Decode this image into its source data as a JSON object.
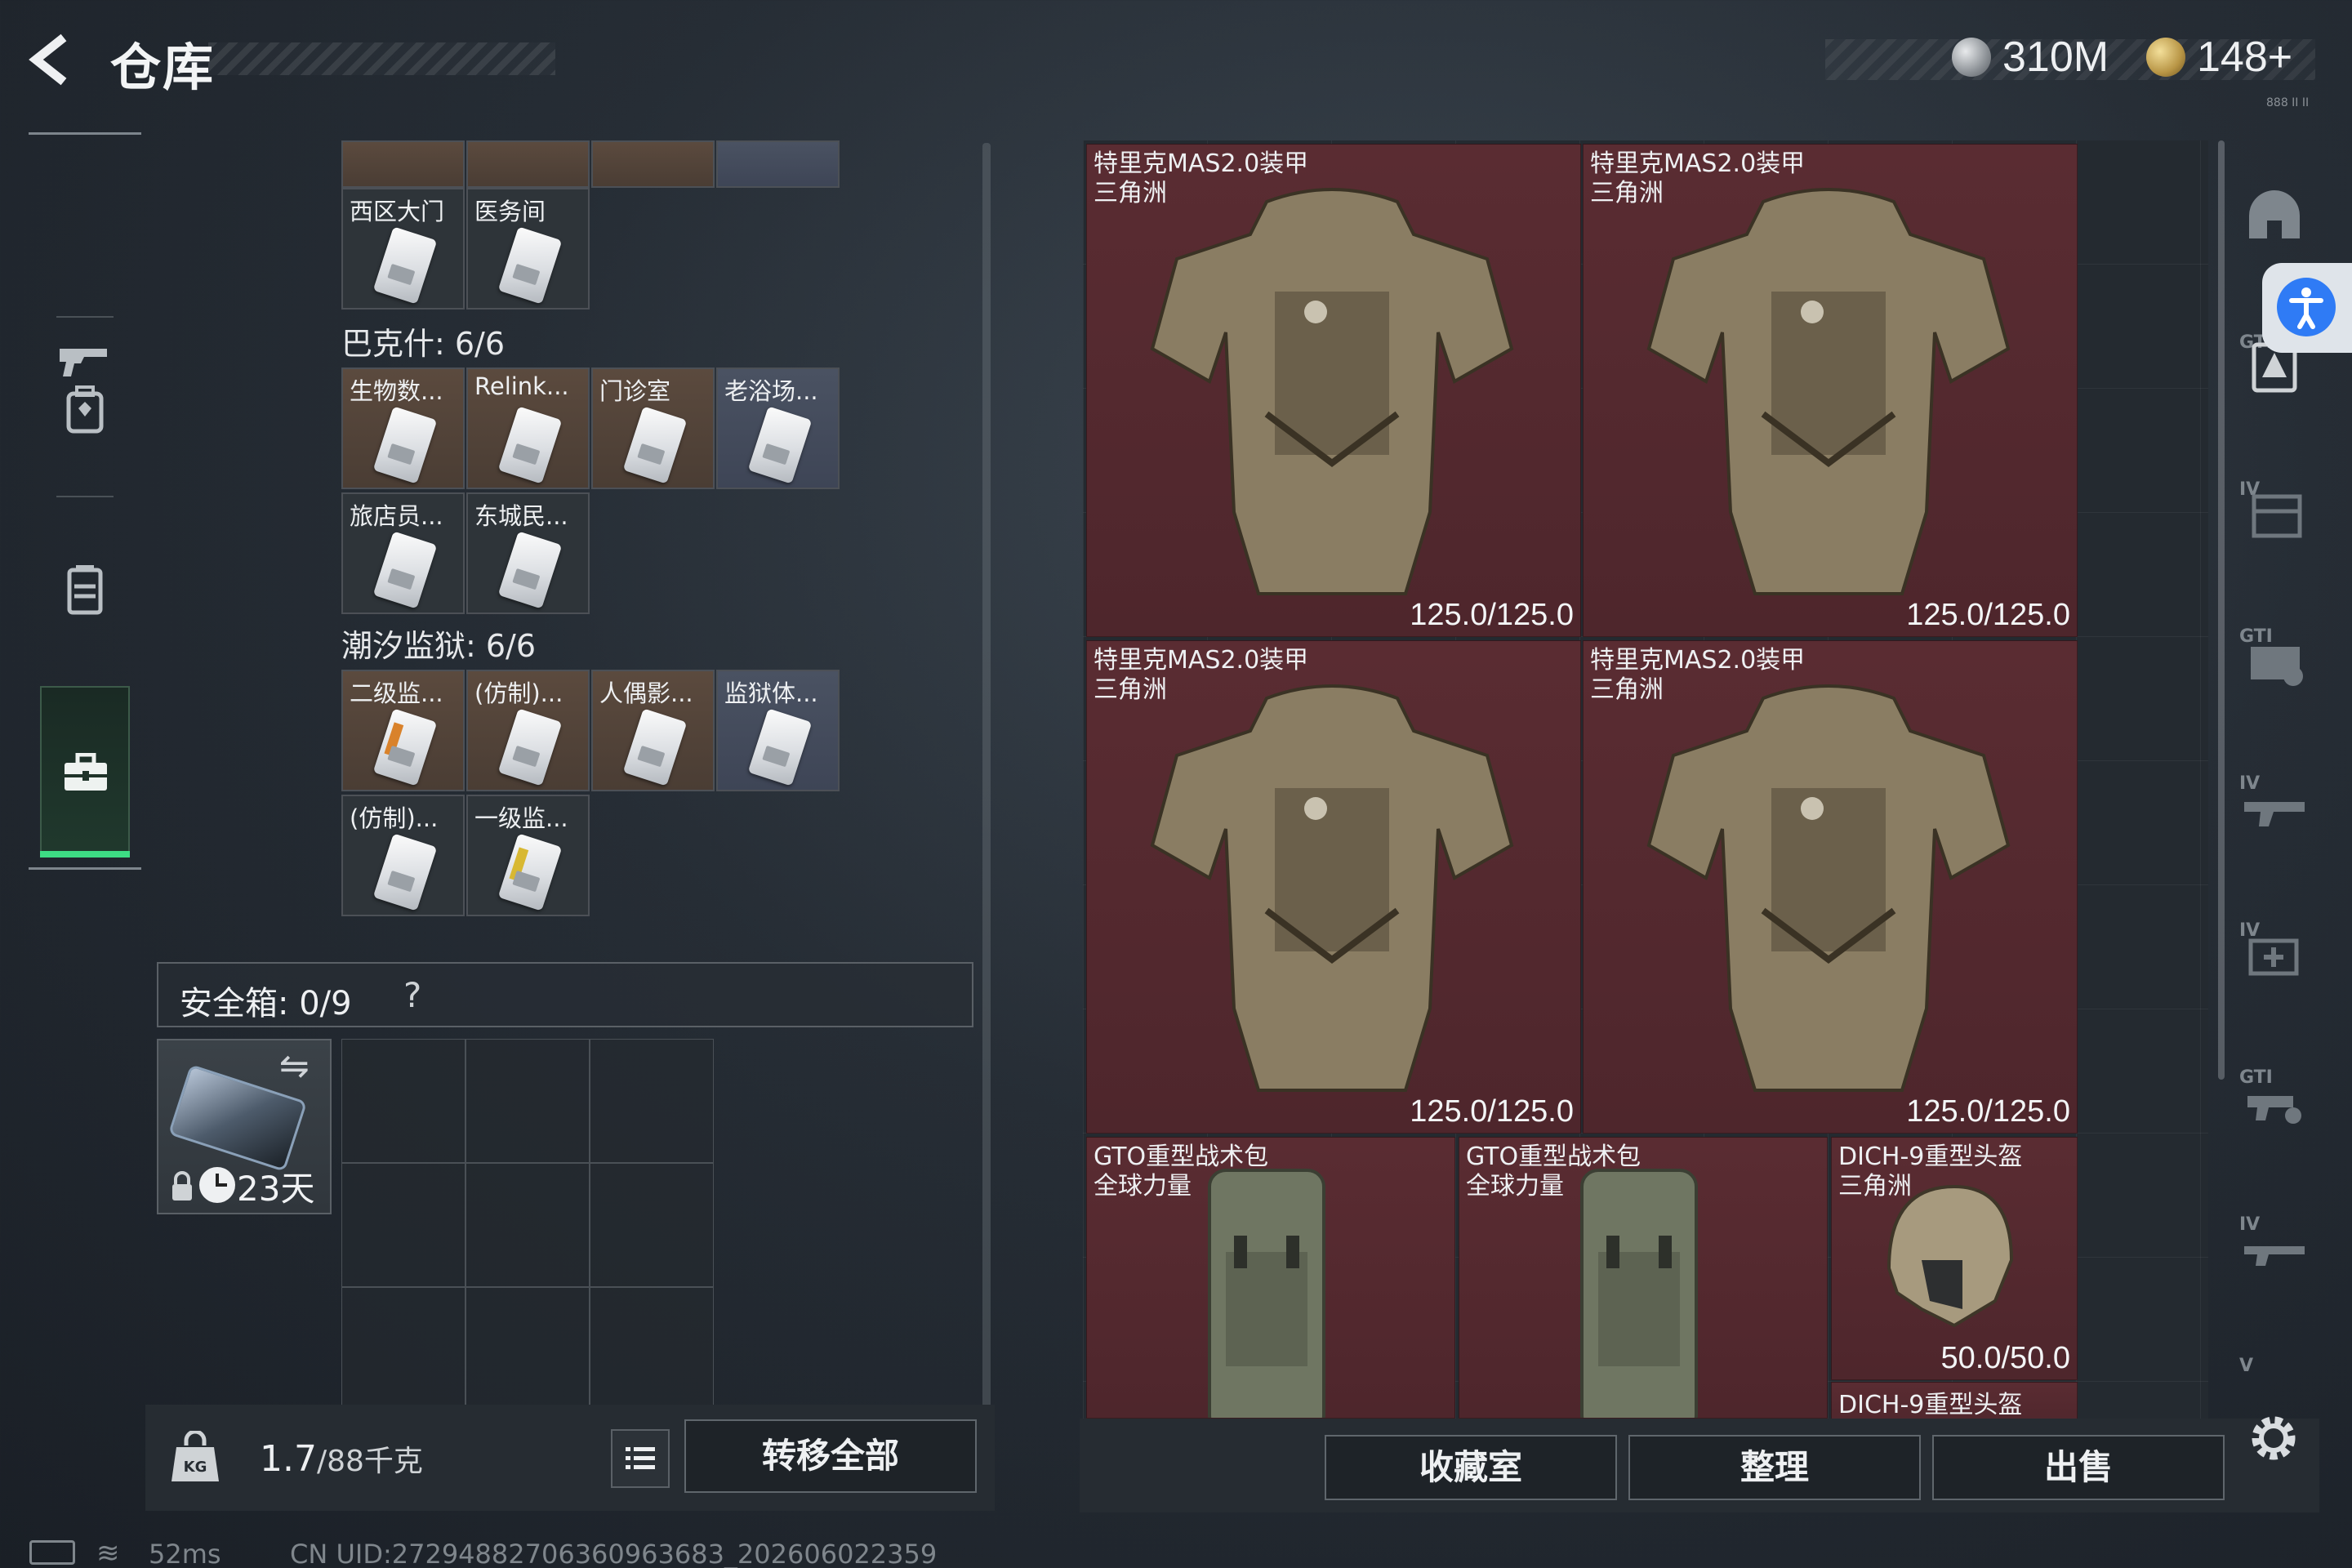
{
  "header": {
    "title": "仓库",
    "currency_silver": "310M",
    "currency_gold": "148+",
    "tiny_label": "888 II II"
  },
  "left_nav": {
    "items": [
      {
        "name": "weapons",
        "icon": "gun-icon"
      },
      {
        "name": "backpack",
        "icon": "backpack-icon"
      },
      {
        "name": "armor",
        "icon": "vest-icon"
      },
      {
        "name": "keys",
        "icon": "briefcase-icon",
        "active": true
      }
    ]
  },
  "key_sections": {
    "top_row_labels": [
      "西区大门",
      "医务间"
    ],
    "bakesh": {
      "title": "巴克什: 6/6",
      "cards": [
        "生物数...",
        "Relink...",
        "门诊室",
        "老浴场...",
        "旅店员...",
        "东城民..."
      ]
    },
    "tidal_prison": {
      "title": "潮汐监狱: 6/6",
      "cards": [
        "二级监...",
        "(仿制)...",
        "人偶影...",
        "监狱体...",
        "(仿制)...",
        "一级监..."
      ]
    }
  },
  "safe_box": {
    "label": "安全箱:  0/9",
    "help": "?",
    "days": "23天",
    "swap_icon": "⇋"
  },
  "weight": {
    "current": "1.7",
    "max": "/88千克",
    "transfer_all": "转移全部"
  },
  "status": {
    "ping": "52ms",
    "uid": "CN UID:2729488270636096368​3_202606022359"
  },
  "stash": {
    "armors": [
      {
        "name": "特里克MAS2.0装甲",
        "origin": "三角洲",
        "durability": "125.0/125.0"
      },
      {
        "name": "特里克MAS2.0装甲",
        "origin": "三角洲",
        "durability": "125.0/125.0"
      },
      {
        "name": "特里克MAS2.0装甲",
        "origin": "三角洲",
        "durability": "125.0/125.0"
      },
      {
        "name": "特里克MAS2.0装甲",
        "origin": "三角洲",
        "durability": "125.0/125.0"
      }
    ],
    "bags": [
      {
        "name": "GTO重型战术包",
        "origin": "全球力量"
      },
      {
        "name": "GTO重型战术包",
        "origin": "全球力量"
      }
    ],
    "helmet": {
      "name": "DICH-9重型头盔",
      "origin": "三角洲",
      "durability": "50.0/50.0"
    },
    "helmet_next": "DICH-9重型头盔",
    "buttons": {
      "collection": "收藏室",
      "sort": "整理",
      "sell": "出售"
    }
  },
  "rail": {
    "tags": [
      "GTI",
      "IV",
      "GTI",
      "IV",
      "IV",
      "GTI",
      "IV",
      "V"
    ]
  },
  "colors": {
    "accent_green": "#3ddc84",
    "item_red": "#5a2c32",
    "accessibility_blue": "#2f7bf5"
  }
}
